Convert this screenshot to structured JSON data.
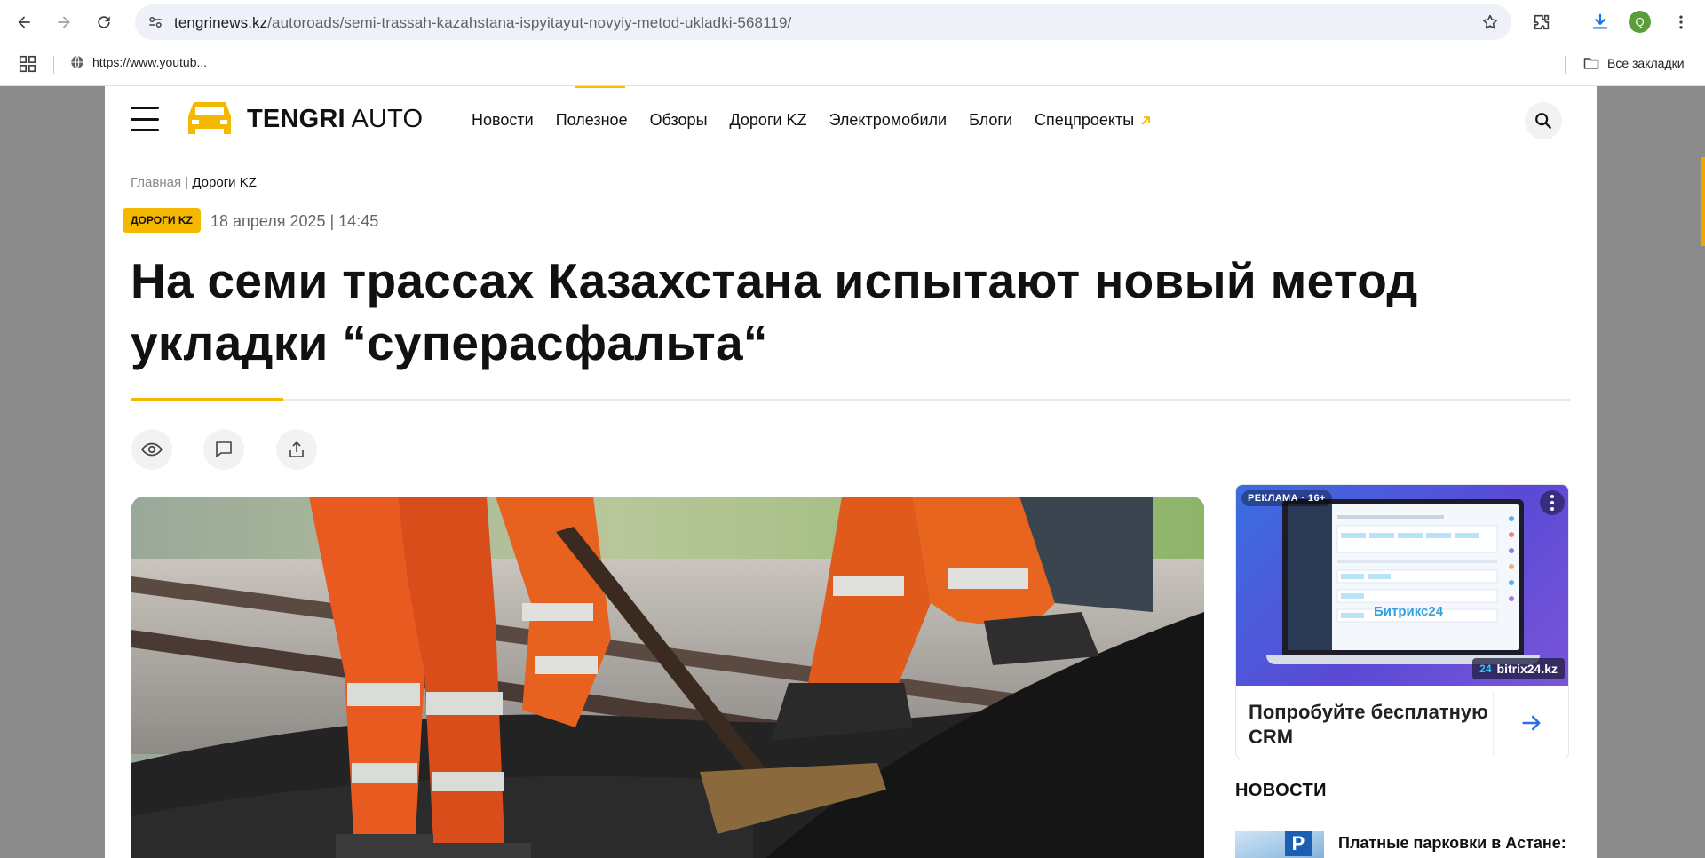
{
  "browser": {
    "url_host": "tengrinews.kz",
    "url_path": "/autoroads/semi-trassah-kazahstana-ispyitayut-novyiy-metod-ukladki-568119/",
    "profile_initial": "Q",
    "bookmark_item": "https://www.youtub...",
    "all_bookmarks": "Все закладки"
  },
  "site": {
    "logo_bold": "TENGRI",
    "logo_light": "AUTO",
    "nav": [
      "Новости",
      "Полезное",
      "Обзоры",
      "Дороги KZ",
      "Электромобили",
      "Блоги",
      "Спецпроекты"
    ],
    "accent_color": "#f5b800"
  },
  "article": {
    "breadcrumb_home": "Главная",
    "breadcrumb_sep": "|",
    "breadcrumb_current": "Дороги KZ",
    "category_badge": "ДОРОГИ KZ",
    "date": "18 апреля 2025 | 14:45",
    "title": "На семи трассах Казахстана испытают новый метод укладки “суперасфальта“"
  },
  "ad": {
    "label": "РЕКЛАМА · 16+",
    "domain": "bitrix24.kz",
    "domain_mark": "24",
    "brand": "Битрикс24",
    "text": "Попробуйте бесплатную CRM"
  },
  "sidebar": {
    "news_heading": "НОВОСТИ",
    "news_item_title": "Платные парковки в Астане:",
    "news_thumb_letter": "P"
  }
}
